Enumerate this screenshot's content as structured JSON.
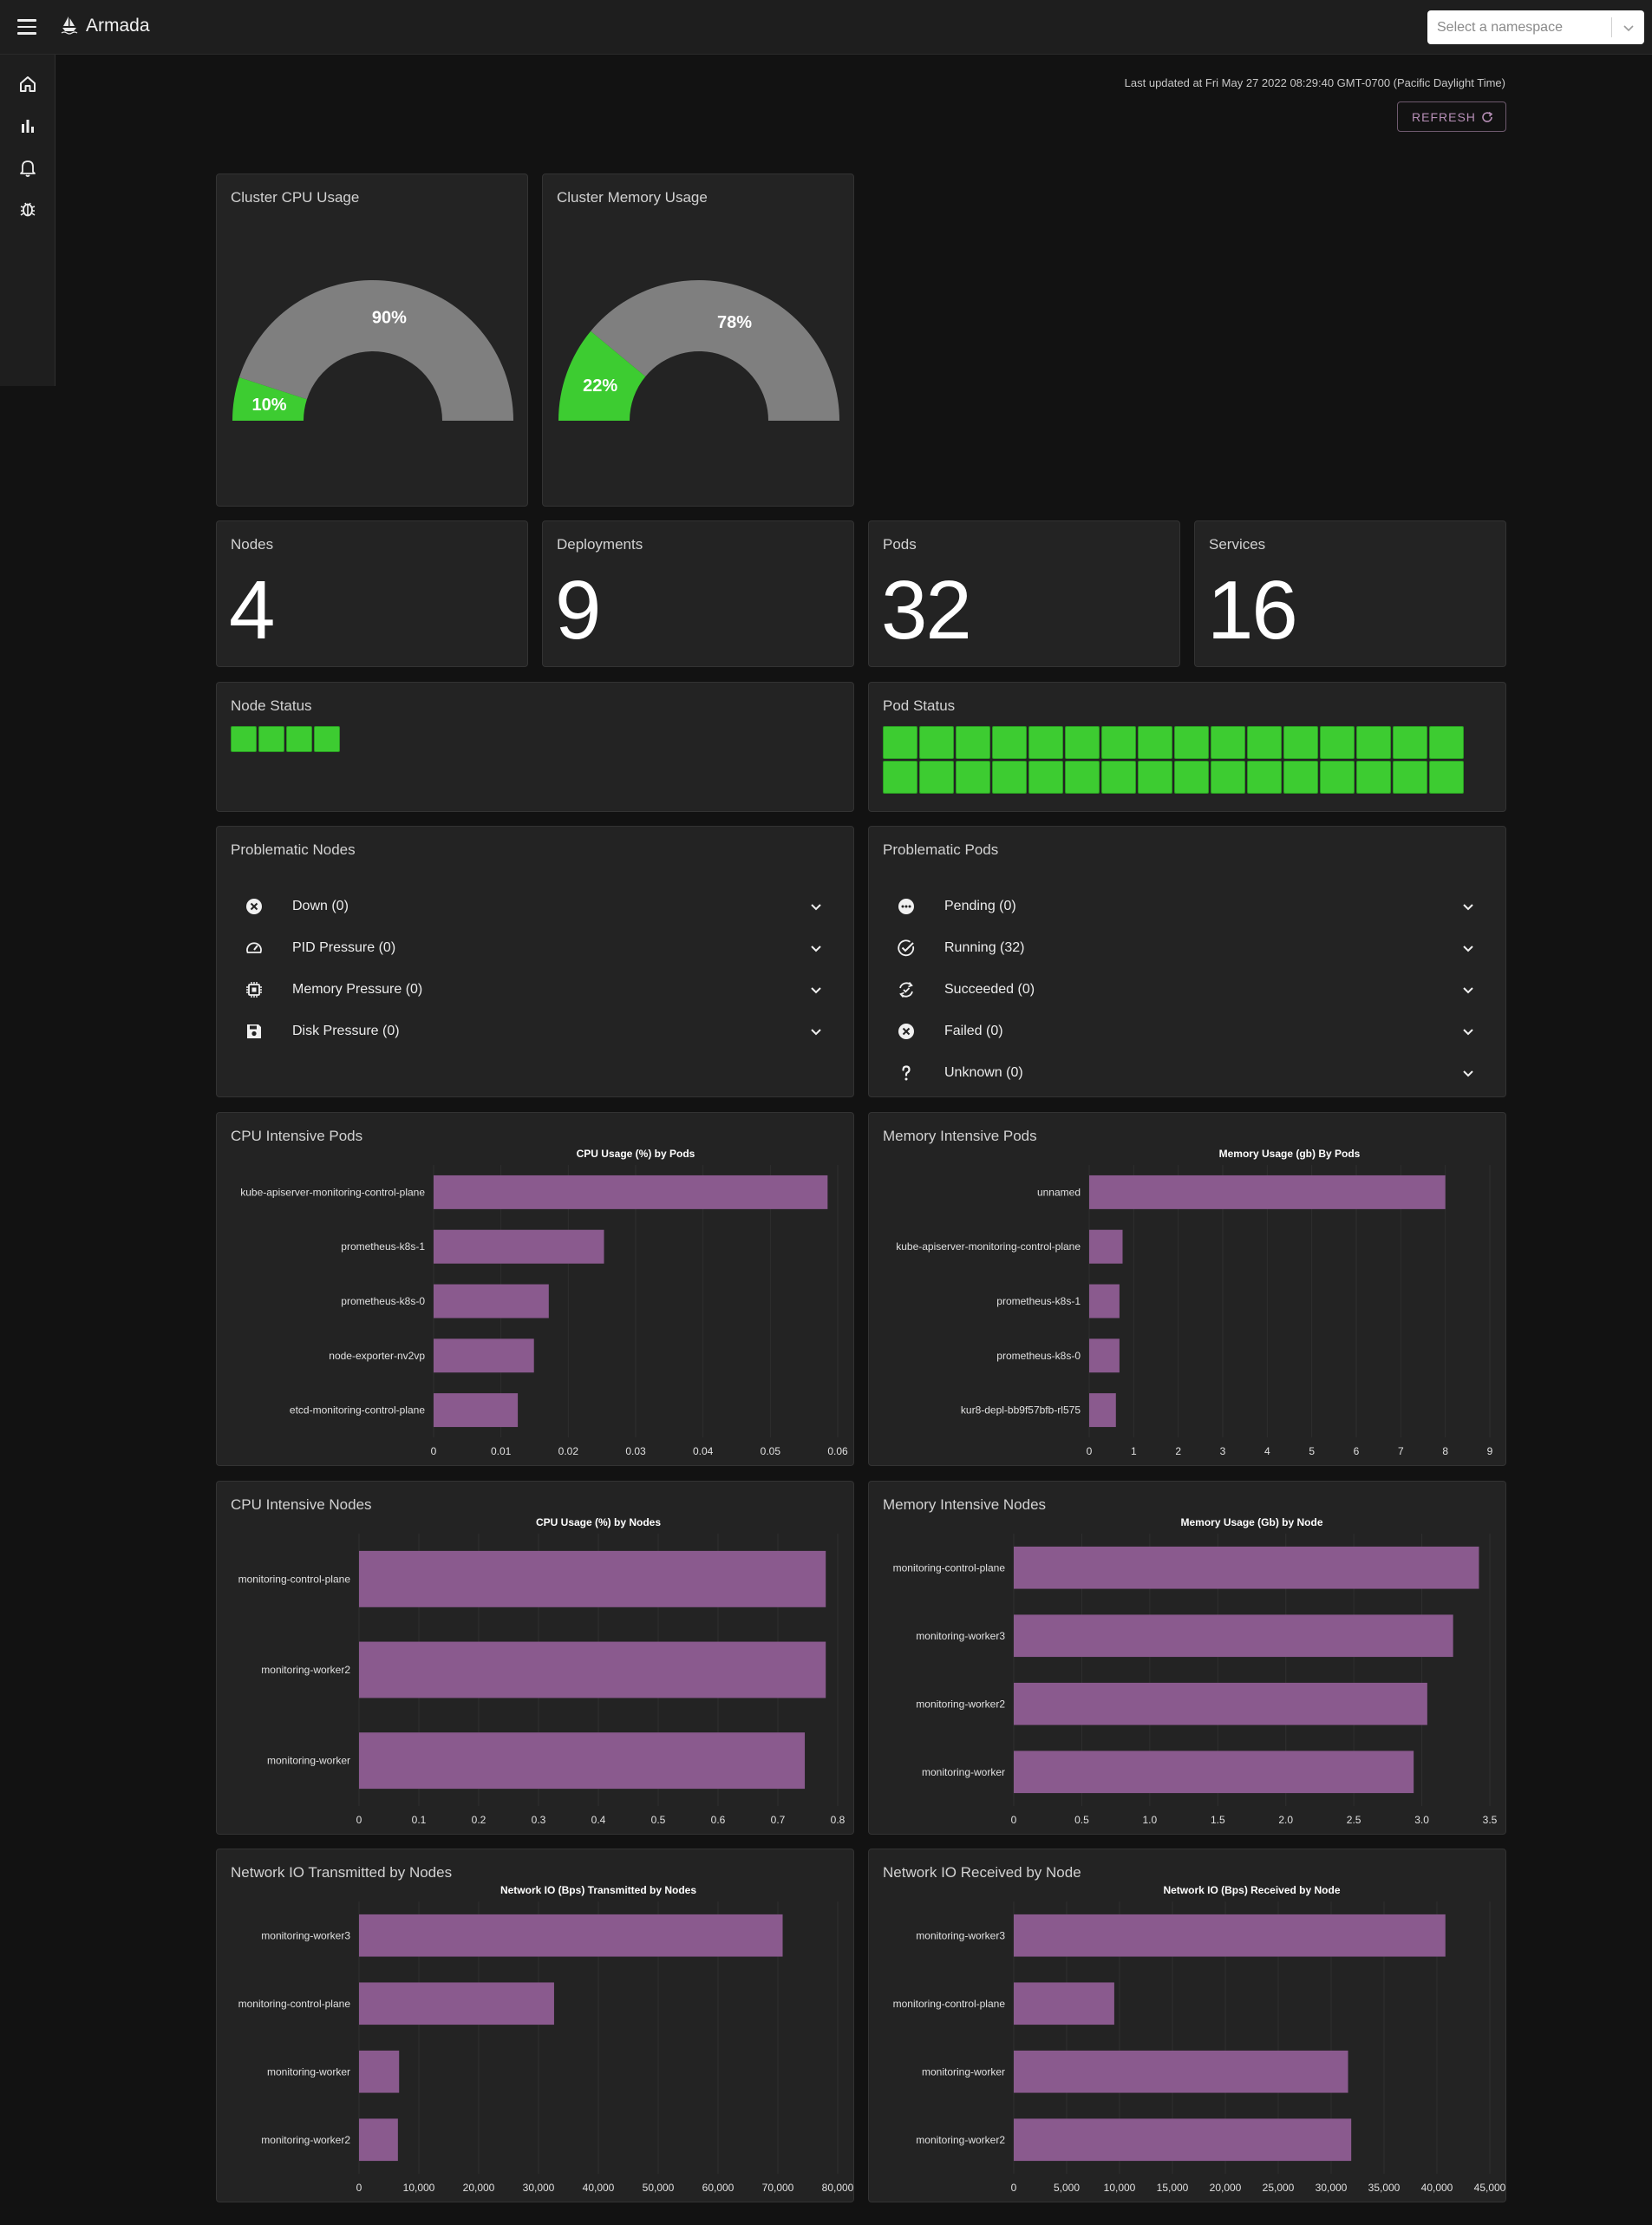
{
  "app": {
    "title": "Armada",
    "namespace_placeholder": "Select a namespace"
  },
  "nav": [
    "home-icon",
    "bar-chart-icon",
    "bell-icon",
    "bug-icon"
  ],
  "header": {
    "last_updated": "Last updated at Fri May 27 2022 08:29:40 GMT-0700 (Pacific Daylight Time)",
    "refresh_label": "REFRESH"
  },
  "colors": {
    "green": "#3dcc31",
    "grey": "#7f7f7f",
    "bar": "#8a5a8e",
    "accent": "#b78fb7"
  },
  "gauges": {
    "cpu": {
      "title": "Cluster CPU Usage",
      "used_pct": 10,
      "free_pct": 90,
      "used_label": "10%",
      "free_label": "90%"
    },
    "memory": {
      "title": "Cluster Memory Usage",
      "used_pct": 22,
      "free_pct": 78,
      "used_label": "22%",
      "free_label": "78%"
    }
  },
  "stats": {
    "nodes": {
      "label": "Nodes",
      "value": "4"
    },
    "deployments": {
      "label": "Deployments",
      "value": "9"
    },
    "pods": {
      "label": "Pods",
      "value": "32"
    },
    "services": {
      "label": "Services",
      "value": "16"
    }
  },
  "node_status": {
    "title": "Node Status",
    "count": 4
  },
  "pod_status": {
    "title": "Pod Status",
    "count": 32
  },
  "problematic_nodes": {
    "title": "Problematic Nodes",
    "items": [
      {
        "icon": "x-circle-icon",
        "label": "Down (0)"
      },
      {
        "icon": "gauge-icon",
        "label": "PID Pressure (0)"
      },
      {
        "icon": "memory-chip-icon",
        "label": "Memory Pressure (0)"
      },
      {
        "icon": "floppy-disk-icon",
        "label": "Disk Pressure (0)"
      }
    ]
  },
  "problematic_pods": {
    "title": "Problematic Pods",
    "items": [
      {
        "icon": "pending-dots-icon",
        "label": "Pending (0)"
      },
      {
        "icon": "check-circle-icon",
        "label": "Running (32)"
      },
      {
        "icon": "sync-check-icon",
        "label": "Succeeded (0)"
      },
      {
        "icon": "x-circle-icon",
        "label": "Failed (0)"
      },
      {
        "icon": "question-mark-icon",
        "label": "Unknown (0)"
      }
    ]
  },
  "panels": {
    "cpu_pods": {
      "title": "CPU Intensive Pods"
    },
    "mem_pods": {
      "title": "Memory Intensive Pods"
    },
    "cpu_nodes": {
      "title": "CPU Intensive Nodes"
    },
    "mem_nodes": {
      "title": "Memory Intensive Nodes"
    },
    "net_tx": {
      "title": "Network IO Transmitted by Nodes"
    },
    "net_rx": {
      "title": "Network IO Received by Node"
    }
  },
  "chart_data": [
    {
      "id": "cpu_pods",
      "type": "bar",
      "orientation": "horizontal",
      "title": "CPU Usage (%) by Pods",
      "categories": [
        "kube-apiserver-monitoring-control-plane",
        "prometheus-k8s-1",
        "prometheus-k8s-0",
        "node-exporter-nv2vp",
        "etcd-monitoring-control-plane"
      ],
      "values": [
        0.0585,
        0.0253,
        0.0171,
        0.0149,
        0.0125
      ],
      "xlim": [
        0,
        0.06
      ],
      "ticks": [
        "0",
        "0.01",
        "0.02",
        "0.03",
        "0.04",
        "0.05",
        "0.06"
      ],
      "tick_values": [
        0,
        0.01,
        0.02,
        0.03,
        0.04,
        0.05,
        0.06
      ]
    },
    {
      "id": "mem_pods",
      "type": "bar",
      "orientation": "horizontal",
      "title": "Memory Usage (gb) By Pods",
      "categories": [
        "unnamed",
        "kube-apiserver-monitoring-control-plane",
        "prometheus-k8s-1",
        "prometheus-k8s-0",
        "kur8-depl-bb9f57bfb-rl575"
      ],
      "values": [
        8.0,
        0.75,
        0.68,
        0.68,
        0.6
      ],
      "xlim": [
        0,
        9
      ],
      "ticks": [
        "0",
        "1",
        "2",
        "3",
        "4",
        "5",
        "6",
        "7",
        "8",
        "9"
      ],
      "tick_values": [
        0,
        1,
        2,
        3,
        4,
        5,
        6,
        7,
        8,
        9
      ]
    },
    {
      "id": "cpu_nodes",
      "type": "bar",
      "orientation": "horizontal",
      "title": "CPU Usage (%) by Nodes",
      "categories": [
        "monitoring-control-plane",
        "monitoring-worker2",
        "monitoring-worker"
      ],
      "values": [
        0.78,
        0.78,
        0.745
      ],
      "xlim": [
        0,
        0.8
      ],
      "ticks": [
        "0",
        "0.1",
        "0.2",
        "0.3",
        "0.4",
        "0.5",
        "0.6",
        "0.7",
        "0.8"
      ],
      "tick_values": [
        0,
        0.1,
        0.2,
        0.3,
        0.4,
        0.5,
        0.6,
        0.7,
        0.8
      ]
    },
    {
      "id": "mem_nodes",
      "type": "bar",
      "orientation": "horizontal",
      "title": "Memory Usage (Gb) by Node",
      "categories": [
        "monitoring-control-plane",
        "monitoring-worker3",
        "monitoring-worker2",
        "monitoring-worker"
      ],
      "values": [
        3.42,
        3.23,
        3.04,
        2.94
      ],
      "xlim": [
        0,
        3.5
      ],
      "ticks": [
        "0",
        "0.5",
        "1.0",
        "1.5",
        "2.0",
        "2.5",
        "3.0",
        "3.5"
      ],
      "tick_values": [
        0,
        0.5,
        1.0,
        1.5,
        2.0,
        2.5,
        3.0,
        3.5
      ]
    },
    {
      "id": "net_tx",
      "type": "bar",
      "orientation": "horizontal",
      "title": "Network IO (Bps) Transmitted by Nodes",
      "categories": [
        "monitoring-worker3",
        "monitoring-control-plane",
        "monitoring-worker",
        "monitoring-worker2"
      ],
      "values": [
        70800,
        32600,
        6700,
        6500
      ],
      "xlim": [
        0,
        80000
      ],
      "ticks": [
        "0",
        "10,000",
        "20,000",
        "30,000",
        "40,000",
        "50,000",
        "60,000",
        "70,000",
        "80,000"
      ],
      "tick_values": [
        0,
        10000,
        20000,
        30000,
        40000,
        50000,
        60000,
        70000,
        80000
      ]
    },
    {
      "id": "net_rx",
      "type": "bar",
      "orientation": "horizontal",
      "title": "Network IO (Bps) Received by Node",
      "categories": [
        "monitoring-worker3",
        "monitoring-control-plane",
        "monitoring-worker",
        "monitoring-worker2"
      ],
      "values": [
        40800,
        9500,
        31600,
        31900
      ],
      "xlim": [
        0,
        45000
      ],
      "ticks": [
        "0",
        "5,000",
        "10,000",
        "15,000",
        "20,000",
        "25,000",
        "30,000",
        "35,000",
        "40,000",
        "45,000"
      ],
      "tick_values": [
        0,
        5000,
        10000,
        15000,
        20000,
        25000,
        30000,
        35000,
        40000,
        45000
      ]
    }
  ]
}
